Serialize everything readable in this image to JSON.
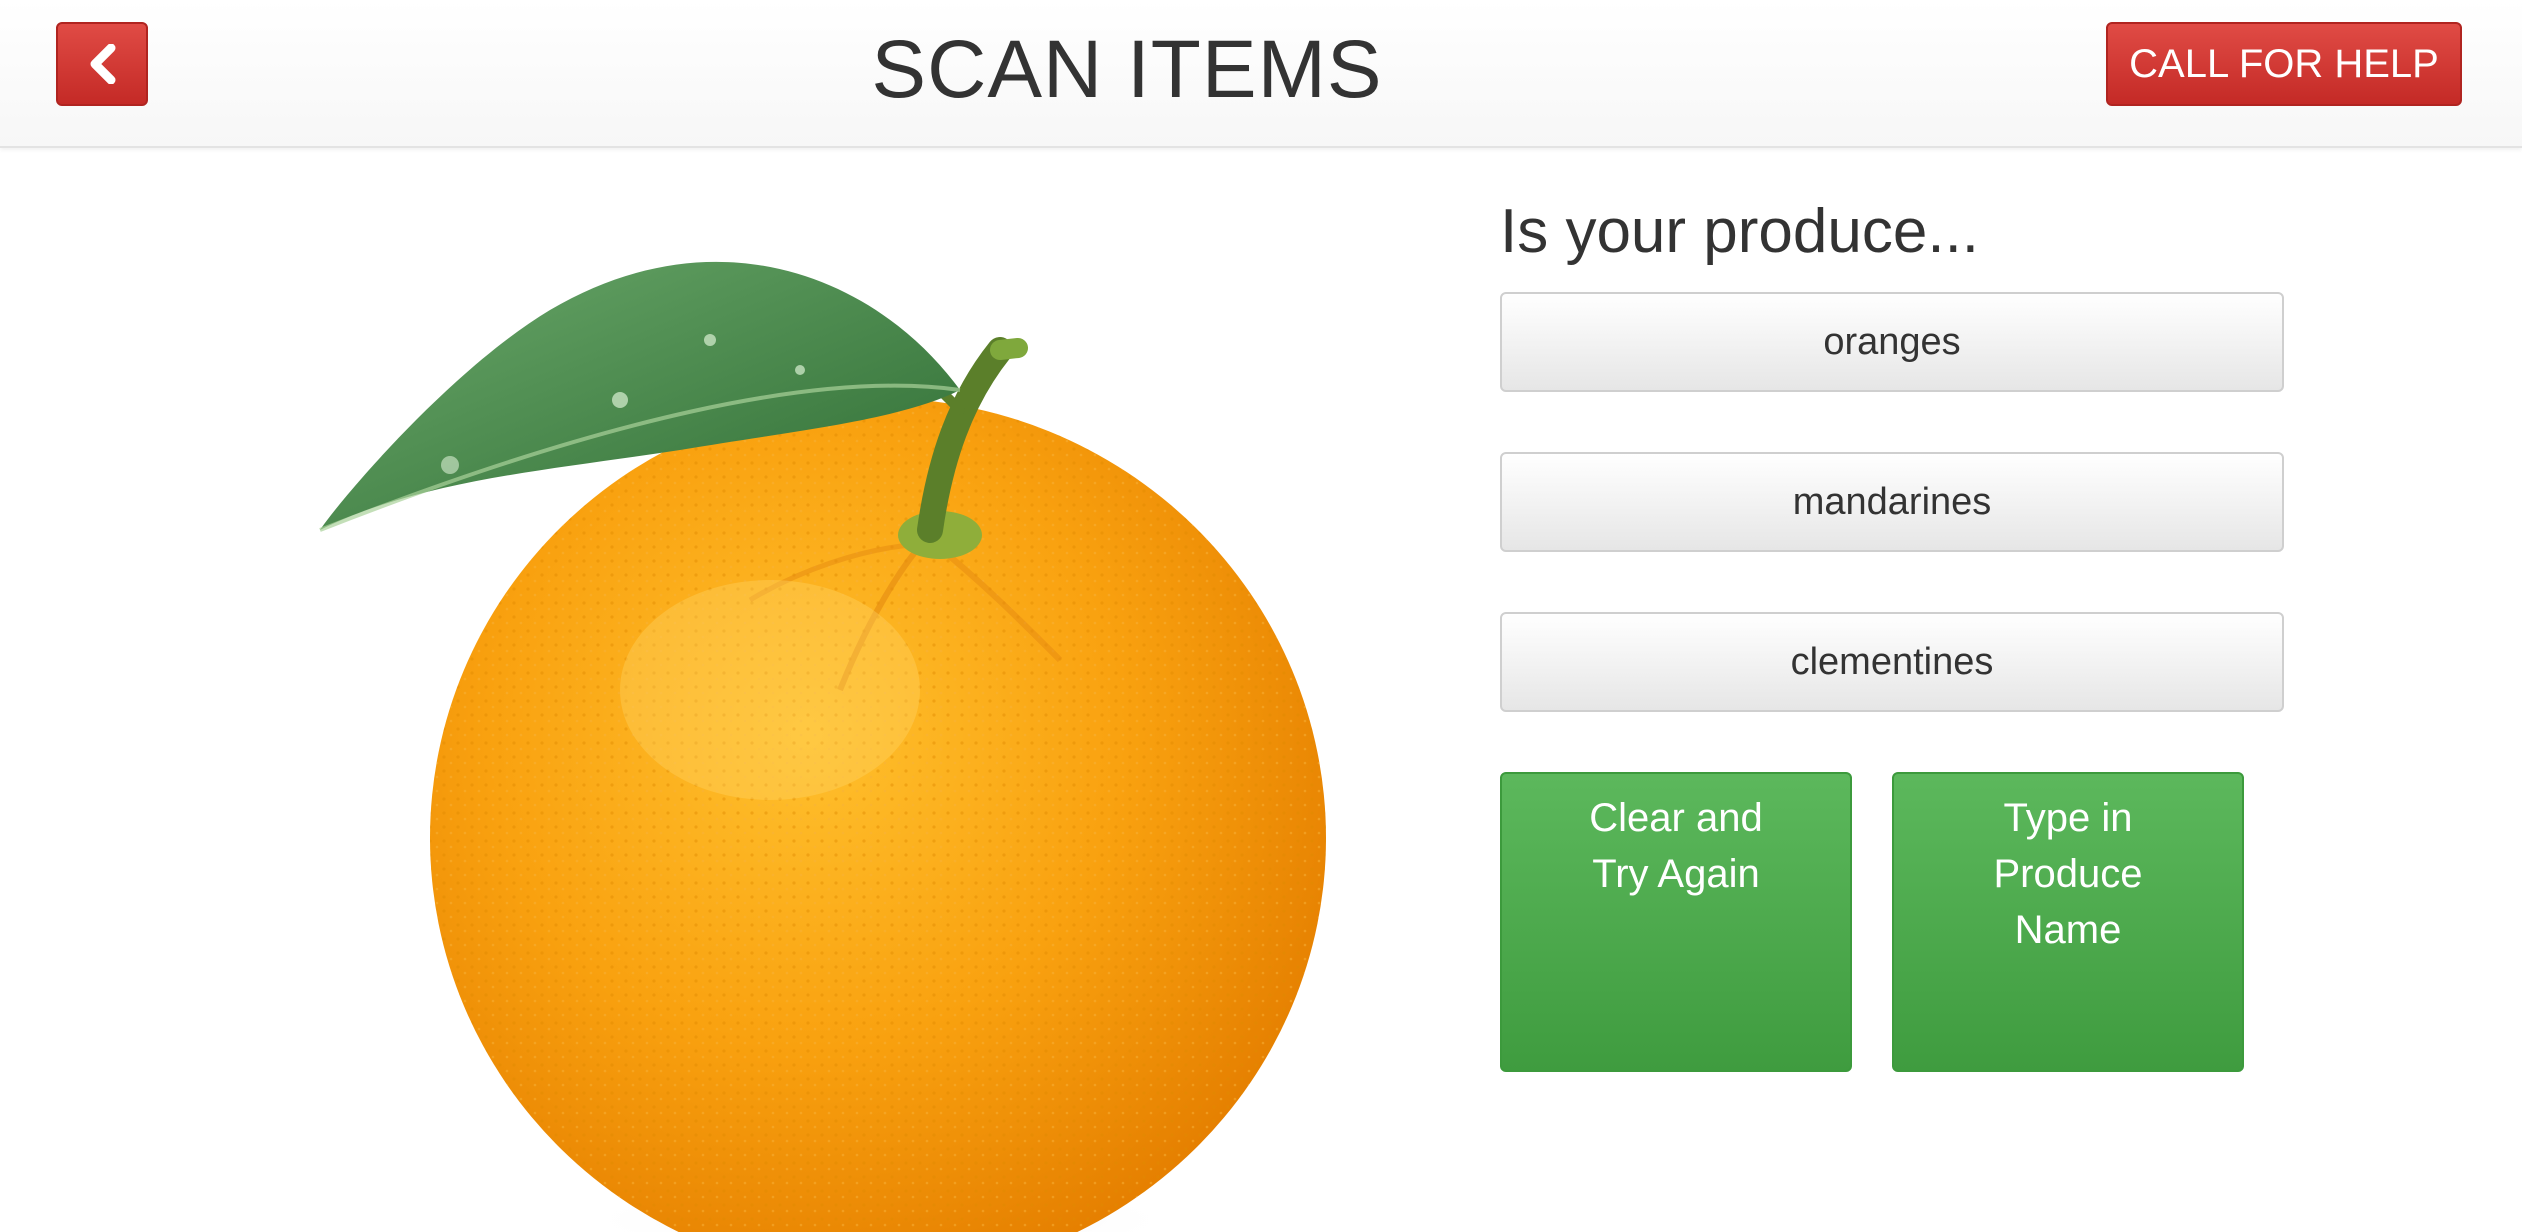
{
  "header": {
    "title": "SCAN ITEMS",
    "back_icon": "chevron-left-icon",
    "help_label": "CALL FOR HELP",
    "accent_color": "#d9534f"
  },
  "image": {
    "subject": "orange"
  },
  "question": "Is your produce...",
  "choices": [
    {
      "label": "oranges"
    },
    {
      "label": "mandarines"
    },
    {
      "label": "clementines"
    }
  ],
  "actions": {
    "clear": {
      "lines": [
        "Clear and",
        "Try Again"
      ]
    },
    "type_in": {
      "lines": [
        "Type in",
        "Produce",
        "Name"
      ]
    },
    "color": "#5cb85c"
  }
}
